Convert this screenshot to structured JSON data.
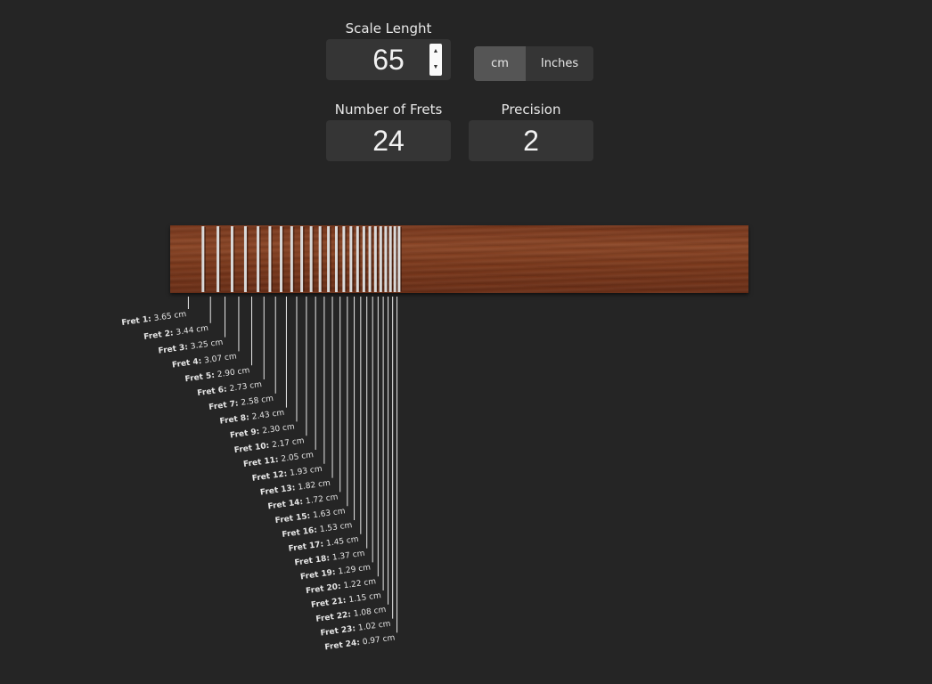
{
  "controls": {
    "scale_label": "Scale Lenght",
    "scale_value": "65",
    "frets_label": "Number of Frets",
    "frets_value": "24",
    "precision_label": "Precision",
    "precision_value": "2",
    "unit_cm": "cm",
    "unit_inches": "Inches",
    "selected_unit": "cm"
  },
  "frets": [
    {
      "label": "Fret 1:",
      "value": "3.65 cm"
    },
    {
      "label": "Fret 2:",
      "value": "3.44 cm"
    },
    {
      "label": "Fret 3:",
      "value": "3.25 cm"
    },
    {
      "label": "Fret 4:",
      "value": "3.07 cm"
    },
    {
      "label": "Fret 5:",
      "value": "2.90 cm"
    },
    {
      "label": "Fret 6:",
      "value": "2.73 cm"
    },
    {
      "label": "Fret 7:",
      "value": "2.58 cm"
    },
    {
      "label": "Fret 8:",
      "value": "2.43 cm"
    },
    {
      "label": "Fret 9:",
      "value": "2.30 cm"
    },
    {
      "label": "Fret 10:",
      "value": "2.17 cm"
    },
    {
      "label": "Fret 11:",
      "value": "2.05 cm"
    },
    {
      "label": "Fret 12:",
      "value": "1.93 cm"
    },
    {
      "label": "Fret 13:",
      "value": "1.82 cm"
    },
    {
      "label": "Fret 14:",
      "value": "1.72 cm"
    },
    {
      "label": "Fret 15:",
      "value": "1.63 cm"
    },
    {
      "label": "Fret 16:",
      "value": "1.53 cm"
    },
    {
      "label": "Fret 17:",
      "value": "1.45 cm"
    },
    {
      "label": "Fret 18:",
      "value": "1.37 cm"
    },
    {
      "label": "Fret 19:",
      "value": "1.29 cm"
    },
    {
      "label": "Fret 20:",
      "value": "1.22 cm"
    },
    {
      "label": "Fret 21:",
      "value": "1.15 cm"
    },
    {
      "label": "Fret 22:",
      "value": "1.08 cm"
    },
    {
      "label": "Fret 23:",
      "value": "1.02 cm"
    },
    {
      "label": "Fret 24:",
      "value": "0.97 cm"
    }
  ],
  "colors": {
    "background": "#252525",
    "input_bg": "#353535",
    "selected_unit_bg": "#555555",
    "wood": "#7c3b1e",
    "fret_wire": "#d9d9d9"
  }
}
